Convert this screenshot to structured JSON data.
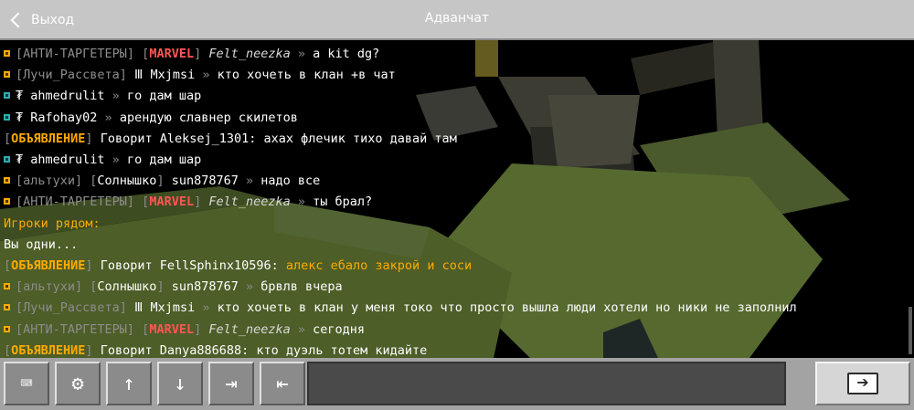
{
  "header": {
    "back_label": "Выход",
    "title": "Адванчат"
  },
  "colors": {
    "orange": "#ffaa00",
    "red": "#ff5555",
    "gray": "#8c8c8c",
    "teal": "#2ab0b0"
  },
  "chat": {
    "lines": [
      {
        "bullet": "orange",
        "segs": [
          [
            "gray",
            "[АНТИ-ТАРГЕТЕРЫ] ["
          ],
          [
            "red",
            "MARVEL"
          ],
          [
            "gray",
            "] "
          ],
          [
            "ital",
            "Felt_neezka"
          ],
          [
            "gray",
            " » "
          ],
          [
            "white",
            " a kit dg?"
          ]
        ]
      },
      {
        "bullet": "orange",
        "segs": [
          [
            "gray",
            "[Лучи_Рассвета] "
          ],
          [
            "white",
            "Ⅲ Mxjmsi"
          ],
          [
            "gray",
            " » "
          ],
          [
            "white",
            "кто хочеть в клан +в чат"
          ]
        ]
      },
      {
        "bullet": "teal",
        "segs": [
          [
            "sym",
            "₮ "
          ],
          [
            "white",
            "ahmedrulit"
          ],
          [
            "gray",
            " » "
          ],
          [
            "white",
            "го дам шар"
          ]
        ]
      },
      {
        "bullet": "teal",
        "segs": [
          [
            "sym",
            "₮ "
          ],
          [
            "white",
            "Rafohay02"
          ],
          [
            "gray",
            " » "
          ],
          [
            "white",
            "арендую славнер скилетов"
          ]
        ]
      },
      {
        "bullet": "",
        "segs": [
          [
            "gray",
            "["
          ],
          [
            "orangeb",
            "ОБЪЯВЛЕНИЕ"
          ],
          [
            "gray",
            "] "
          ],
          [
            "white",
            "Говорит Aleksej_1301: ахах флечик тихо давай там"
          ]
        ]
      },
      {
        "bullet": "teal",
        "segs": [
          [
            "sym",
            "₮ "
          ],
          [
            "white",
            "ahmedrulit"
          ],
          [
            "gray",
            " » "
          ],
          [
            "white",
            "го дам шар"
          ]
        ]
      },
      {
        "bullet": "orange",
        "segs": [
          [
            "gray",
            "[альтухи] ["
          ],
          [
            "white",
            "Солнышко"
          ],
          [
            "gray",
            "] "
          ],
          [
            "white",
            "sun878767"
          ],
          [
            "gray",
            " » "
          ],
          [
            "white",
            " надо все"
          ]
        ]
      },
      {
        "bullet": "orange",
        "segs": [
          [
            "gray",
            "[АНТИ-ТАРГЕТЕРЫ] ["
          ],
          [
            "red",
            "MARVEL"
          ],
          [
            "gray",
            "] "
          ],
          [
            "ital",
            "Felt_neezka"
          ],
          [
            "gray",
            " » "
          ],
          [
            "white",
            " ты брал?"
          ]
        ]
      },
      {
        "bullet": "",
        "segs": [
          [
            "orange",
            "Игроки рядом:"
          ]
        ]
      },
      {
        "bullet": "",
        "segs": [
          [
            "white",
            "Вы одни..."
          ]
        ]
      },
      {
        "bullet": "",
        "segs": [
          [
            "gray",
            "["
          ],
          [
            "orangeb",
            "ОБЪЯВЛЕНИЕ"
          ],
          [
            "gray",
            "] "
          ],
          [
            "white",
            "Говорит FellSphinx10596: "
          ],
          [
            "orange",
            " алекс ебало закрой и соси"
          ]
        ]
      },
      {
        "bullet": "orange",
        "segs": [
          [
            "gray",
            "[альтухи] ["
          ],
          [
            "white",
            "Солнышко"
          ],
          [
            "gray",
            "] "
          ],
          [
            "white",
            "sun878767"
          ],
          [
            "gray",
            " » "
          ],
          [
            "white",
            " брвлв вчера"
          ]
        ]
      },
      {
        "bullet": "orange",
        "segs": [
          [
            "gray",
            "[Лучи_Рассвета] "
          ],
          [
            "white",
            "Ⅲ Mxjmsi"
          ],
          [
            "gray",
            " » "
          ],
          [
            "white",
            "кто хочеть в клан у меня токо что просто вышла люди хотели но ники не заполнил"
          ]
        ]
      },
      {
        "bullet": "orange",
        "segs": [
          [
            "gray",
            "[АНТИ-ТАРГЕТЕРЫ] ["
          ],
          [
            "red",
            "MARVEL"
          ],
          [
            "gray",
            "] "
          ],
          [
            "ital",
            "Felt_neezka"
          ],
          [
            "gray",
            " » "
          ],
          [
            "white",
            " сегодня"
          ]
        ]
      },
      {
        "bullet": "",
        "segs": [
          [
            "gray",
            "["
          ],
          [
            "orangeb",
            "ОБЪЯВЛЕНИЕ"
          ],
          [
            "gray",
            "] "
          ],
          [
            "white",
            "Говорит Danya886688: кто дуэль тотем кидайте"
          ]
        ]
      }
    ]
  },
  "toolbar": {
    "buttons": [
      {
        "name": "keyboard-icon",
        "glyph": "⌨"
      },
      {
        "name": "gear-icon",
        "glyph": "⚙"
      },
      {
        "name": "arrow-up-icon",
        "glyph": "↑"
      },
      {
        "name": "arrow-down-icon",
        "glyph": "↓"
      },
      {
        "name": "autocomplete-next-icon",
        "glyph": "⇥"
      },
      {
        "name": "autocomplete-prev-icon",
        "glyph": "⇤"
      }
    ],
    "input_value": "",
    "send_glyph": "➔"
  }
}
